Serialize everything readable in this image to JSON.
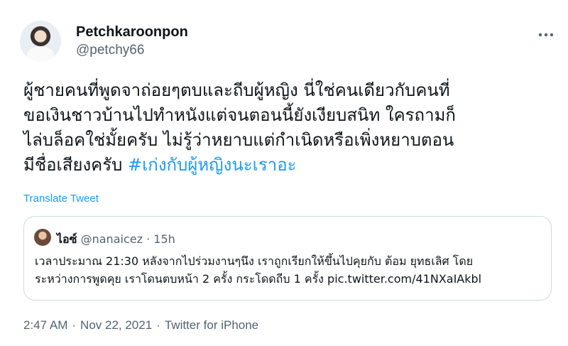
{
  "author": {
    "name": "Petchkaroonpon",
    "handle": "@petchy66",
    "more_icon": "ellipsis-icon"
  },
  "tweet": {
    "lines": [
      "ผู้ชายคนที่พูดจาถ่อยๆตบและถีบผู้หญิง นี่ใช่คนเดียวกับคนที่",
      "ขอเงินชาวบ้านไปทำหนังแต่จนตอนนี้ยังเงียบสนิท ใครถามก็",
      "ไล่บล็อคใช่มั้ยครับ ไม่รู้ว่าหยาบแต่กำเนิดหรือเพิ่งหยาบตอน",
      "มีชื่อเสียงครับ "
    ],
    "hashtag": "#เก่งกับผู้หญิงนะเราอะ",
    "translate": "Translate Tweet"
  },
  "quote": {
    "name": "ไอซ์",
    "handle": "@nanaicez",
    "sep": "·",
    "time": "15h",
    "lines": [
      "เวลาประมาณ 21:30 หลังจากไปร่วมงานๆนึง เราถูกเรียกให้ขึ้นไปคุยกับ ต้อม ยุทธเลิศ โดย",
      "ระหว่างการพูดคุย เราโดนตบหน้า 2 ครั้ง กระโดดถีบ 1 ครั้ง pic.twitter.com/41NXaIAkbl"
    ]
  },
  "footer": {
    "time": "2:47 AM",
    "sep": "·",
    "date": "Nov 22, 2021",
    "source": "Twitter for iPhone"
  },
  "colors": {
    "link": "#1d9bf0",
    "secondary_text": "#536471",
    "border": "#cfd9de"
  }
}
